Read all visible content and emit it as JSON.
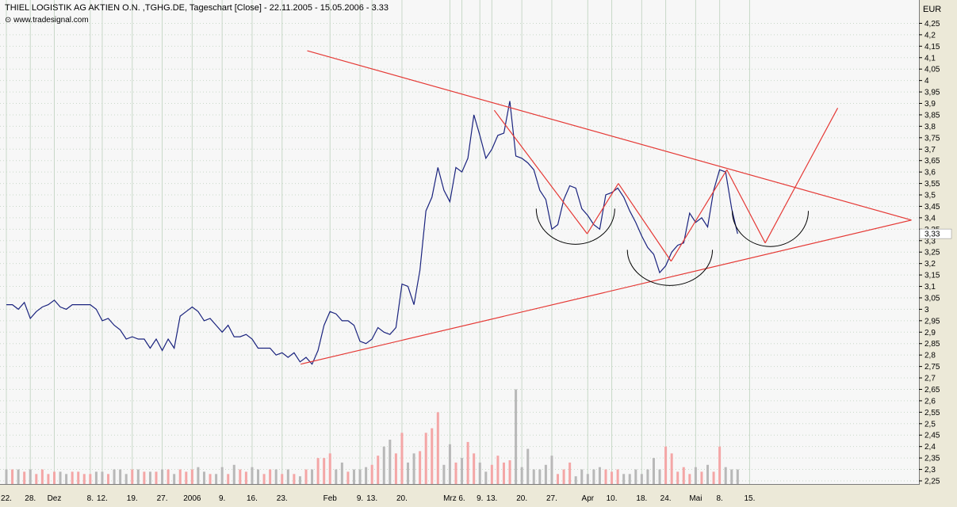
{
  "header": {
    "title": "THIEL LOGISTIK AG AKTIEN O.N. ,TGHG.DE, Tageschart [Close] - 22.11.2005 - 15.05.2006 - 3.33",
    "source": "www.tradesignal.com"
  },
  "colors": {
    "price_line": "#1a237e",
    "trend_lines": "#e53935",
    "pattern_arcs": "#000000",
    "volume_up": "#f4a6a6",
    "volume_down": "#b8b8b8",
    "grid": "#c8d8c8",
    "plot_bg": "#f7f7f7"
  },
  "chart_data": {
    "type": "line",
    "title": "THIEL LOGISTIK AG AKTIEN O.N. ,TGHG.DE, Tageschart [Close] - 22.11.2005 - 15.05.2006 - 3.33",
    "ylabel": "EUR",
    "ylim": [
      2.25,
      4.3
    ],
    "last_value": "3.33",
    "last_value_label": "3,33",
    "y_ticks": [
      "2,25",
      "2,3",
      "2,35",
      "2,4",
      "2,45",
      "2,5",
      "2,55",
      "2,6",
      "2,65",
      "2,7",
      "2,75",
      "2,8",
      "2,85",
      "2,9",
      "2,95",
      "3",
      "3,05",
      "3,1",
      "3,15",
      "3,2",
      "3,25",
      "3,3",
      "3,35",
      "3,4",
      "3,45",
      "3,5",
      "3,55",
      "3,6",
      "3,65",
      "3,7",
      "3,75",
      "3,8",
      "3,85",
      "3,9",
      "3,95",
      "4",
      "4,05",
      "4,1",
      "4,15",
      "4,2",
      "4,25"
    ],
    "x_ticks": [
      {
        "label": "22.",
        "i": 0
      },
      {
        "label": "28.",
        "i": 4
      },
      {
        "label": "Dez",
        "i": 8
      },
      {
        "label": "8.",
        "i": 14
      },
      {
        "label": "12.",
        "i": 16
      },
      {
        "label": "19.",
        "i": 21
      },
      {
        "label": "27.",
        "i": 26
      },
      {
        "label": "2006",
        "i": 31
      },
      {
        "label": "9.",
        "i": 36
      },
      {
        "label": "16.",
        "i": 41
      },
      {
        "label": "23.",
        "i": 46
      },
      {
        "label": "Feb",
        "i": 54
      },
      {
        "label": "9.",
        "i": 59
      },
      {
        "label": "13.",
        "i": 61
      },
      {
        "label": "20.",
        "i": 66
      },
      {
        "label": "Mrz",
        "i": 74
      },
      {
        "label": "6.",
        "i": 76
      },
      {
        "label": "9.",
        "i": 79
      },
      {
        "label": "13.",
        "i": 81
      },
      {
        "label": "20.",
        "i": 86
      },
      {
        "label": "27.",
        "i": 91
      },
      {
        "label": "Apr",
        "i": 97
      },
      {
        "label": "10.",
        "i": 101
      },
      {
        "label": "18.",
        "i": 106
      },
      {
        "label": "24.",
        "i": 110
      },
      {
        "label": "Mai",
        "i": 115
      },
      {
        "label": "8.",
        "i": 119
      },
      {
        "label": "15.",
        "i": 124
      }
    ],
    "series": [
      {
        "values": [
          3.02,
          3.02,
          3.0,
          3.03,
          2.96,
          2.99,
          3.01,
          3.02,
          3.04,
          3.01,
          3.0,
          3.02,
          3.02,
          3.02,
          3.02,
          3.0,
          2.95,
          2.96,
          2.93,
          2.91,
          2.87,
          2.88,
          2.87,
          2.87,
          2.83,
          2.87,
          2.82,
          2.87,
          2.83,
          2.97,
          2.99,
          3.01,
          2.99,
          2.95,
          2.96,
          2.93,
          2.9,
          2.93,
          2.88,
          2.88,
          2.89,
          2.87,
          2.83,
          2.83,
          2.83,
          2.8,
          2.81,
          2.79,
          2.81,
          2.77,
          2.79,
          2.76,
          2.82,
          2.93,
          2.99,
          2.98,
          2.95,
          2.95,
          2.93,
          2.86,
          2.85,
          2.87,
          2.92,
          2.9,
          2.89,
          2.92,
          3.11,
          3.1,
          3.02,
          3.17,
          3.43,
          3.49,
          3.62,
          3.52,
          3.47,
          3.62,
          3.6,
          3.66,
          3.85,
          3.76,
          3.66,
          3.7,
          3.76,
          3.77,
          3.91,
          3.67,
          3.66,
          3.64,
          3.61,
          3.52,
          3.48,
          3.35,
          3.37,
          3.48,
          3.54,
          3.53,
          3.44,
          3.41,
          3.37,
          3.35,
          3.5,
          3.51,
          3.53,
          3.49,
          3.43,
          3.38,
          3.32,
          3.27,
          3.24,
          3.16,
          3.19,
          3.25,
          3.28,
          3.29,
          3.42,
          3.38,
          3.4,
          3.36,
          3.52,
          3.61,
          3.6,
          3.44,
          3.33
        ],
        "volumes": [
          2.3,
          2.3,
          2.3,
          2.29,
          2.3,
          2.28,
          2.3,
          2.28,
          2.29,
          2.29,
          2.28,
          2.29,
          2.29,
          2.28,
          2.28,
          2.29,
          2.29,
          2.28,
          2.3,
          2.3,
          2.28,
          2.3,
          2.3,
          2.29,
          2.29,
          2.29,
          2.3,
          2.3,
          2.28,
          2.3,
          2.29,
          2.3,
          2.31,
          2.29,
          2.28,
          2.28,
          2.31,
          2.28,
          2.32,
          2.3,
          2.29,
          2.31,
          2.3,
          2.28,
          2.3,
          2.3,
          2.28,
          2.3,
          2.28,
          2.27,
          2.3,
          2.3,
          2.35,
          2.35,
          2.37,
          2.3,
          2.33,
          2.29,
          2.3,
          2.3,
          2.31,
          2.32,
          2.36,
          2.4,
          2.43,
          2.37,
          2.46,
          2.33,
          2.37,
          2.38,
          2.46,
          2.48,
          2.55,
          2.32,
          2.41,
          2.33,
          2.35,
          2.42,
          2.37,
          2.33,
          2.29,
          2.32,
          2.36,
          2.33,
          2.34,
          2.65,
          2.31,
          2.39,
          2.3,
          2.3,
          2.32,
          2.36,
          2.28,
          2.3,
          2.33,
          2.27,
          2.3,
          2.28,
          2.3,
          2.31,
          2.3,
          2.29,
          2.3,
          2.28,
          2.28,
          2.3,
          2.28,
          2.3,
          2.35,
          2.3,
          2.4,
          2.37,
          2.29,
          2.31,
          2.28,
          2.31,
          2.29,
          2.32,
          2.29,
          2.4,
          2.31,
          2.3,
          2.3
        ]
      }
    ]
  }
}
